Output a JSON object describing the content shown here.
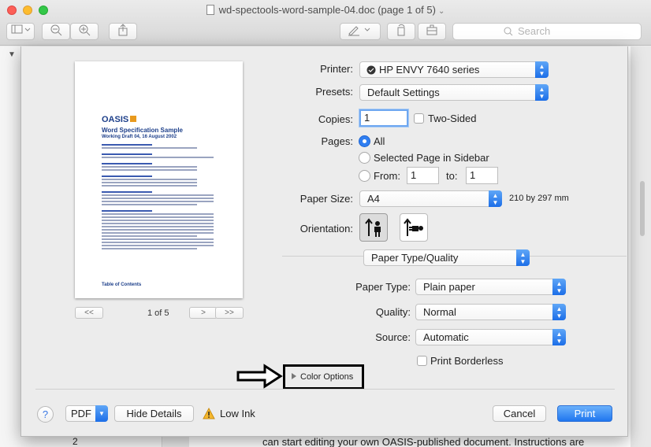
{
  "window": {
    "title": "wd-spectools-word-sample-04.doc (page 1 of 5)",
    "search_placeholder": "Search"
  },
  "background": {
    "doc_text": "can start editing your own OASIS-published document. Instructions are",
    "page_number": "2"
  },
  "preview": {
    "logo": "OASIS",
    "title": "Word Specification Sample",
    "subtitle": "Working Draft 04, 16 August 2002",
    "toc": "Table of Contents",
    "pager": {
      "first": "<<",
      "prev": "<",
      "next": ">",
      "last": ">>",
      "label": "1 of 5"
    }
  },
  "print": {
    "printer_label": "Printer:",
    "printer_value": "HP ENVY 7640 series",
    "presets_label": "Presets:",
    "presets_value": "Default Settings",
    "copies_label": "Copies:",
    "copies_value": "1",
    "two_sided_label": "Two-Sided",
    "pages_label": "Pages:",
    "pages_all": "All",
    "pages_selected": "Selected Page in Sidebar",
    "pages_from": "From:",
    "pages_from_value": "1",
    "pages_to": "to:",
    "pages_to_value": "1",
    "paper_size_label": "Paper Size:",
    "paper_size_value": "A4",
    "paper_size_dims": "210 by 297 mm",
    "orientation_label": "Orientation:",
    "section_value": "Paper Type/Quality",
    "paper_type_label": "Paper Type:",
    "paper_type_value": "Plain paper",
    "quality_label": "Quality:",
    "quality_value": "Normal",
    "source_label": "Source:",
    "source_value": "Automatic",
    "borderless_label": "Print Borderless",
    "color_options": "Color Options"
  },
  "footer": {
    "help": "?",
    "pdf": "PDF",
    "hide_details": "Hide Details",
    "low_ink": "Low Ink",
    "cancel": "Cancel",
    "print": "Print"
  }
}
